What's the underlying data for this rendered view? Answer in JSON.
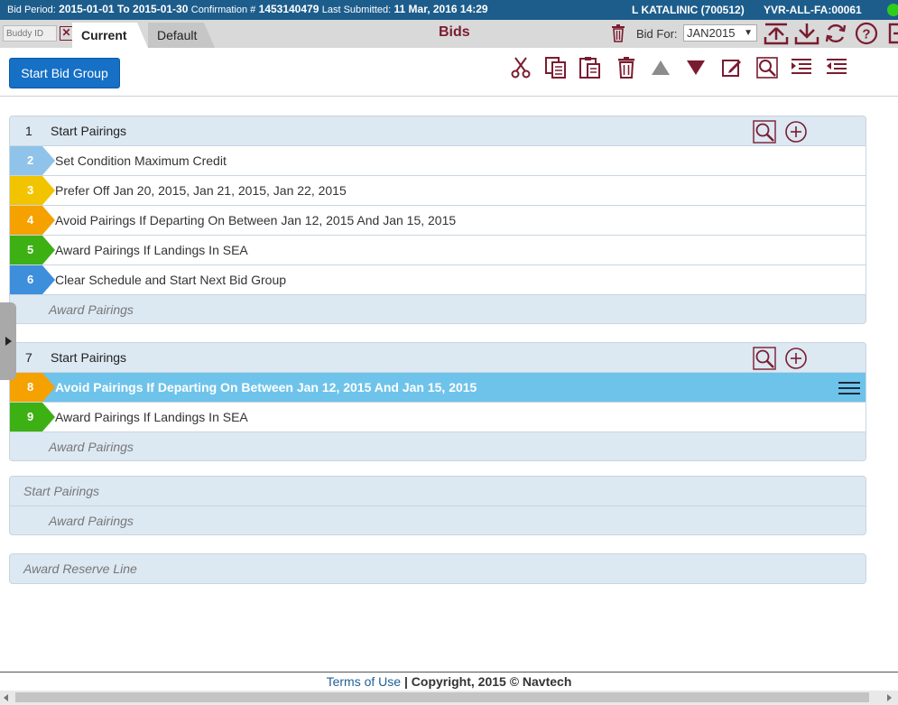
{
  "topbar": {
    "bid_period_label": "Bid Period:",
    "bid_period_value": "2015-01-01",
    "to_label": "To",
    "bid_period_end": "2015-01-30",
    "confirmation_label": "Confirmation #",
    "confirmation_value": "1453140479",
    "last_submitted_label": "Last Submitted:",
    "last_submitted_value": "11 Mar, 2016 14:29",
    "user": "L KATALINIC (700512)",
    "base": "YVR-ALL-FA:00061",
    "status_color": "#2ecc1b"
  },
  "tabs": {
    "buddy_placeholder": "Buddy ID",
    "current": "Current",
    "default": "Default",
    "page_title": "Bids",
    "bid_for_label": "Bid For:",
    "bid_for_value": "JAN2015"
  },
  "toolbar": {
    "start_bid_group": "Start Bid Group",
    "icons": [
      "cut-icon",
      "copy-icon",
      "paste-icon",
      "delete-icon",
      "move-up-icon",
      "move-down-icon",
      "edit-icon",
      "search-icon",
      "indent-icon",
      "outdent-icon"
    ]
  },
  "groups": [
    {
      "number": "1",
      "title": "Start Pairings",
      "rows": [
        {
          "number": "2",
          "text": "Set Condition Maximum Credit",
          "color": "#8fc3ea"
        },
        {
          "number": "3",
          "text": "Prefer Off Jan 20, 2015, Jan 21, 2015, Jan 22, 2015",
          "color": "#f2c400"
        },
        {
          "number": "4",
          "text": "Avoid Pairings If Departing On Between Jan 12, 2015 And Jan 15, 2015",
          "color": "#f5a100"
        },
        {
          "number": "5",
          "text": "Award Pairings If Landings In SEA",
          "color": "#3db014"
        },
        {
          "number": "6",
          "text": "Clear Schedule and Start Next Bid Group",
          "color": "#3d8fdc"
        }
      ],
      "award": "Award Pairings"
    },
    {
      "number": "7",
      "title": "Start Pairings",
      "rows": [
        {
          "number": "8",
          "text": "Avoid Pairings If Departing On Between Jan 12, 2015 And Jan 15, 2015",
          "color": "#f5a100",
          "selected": true
        },
        {
          "number": "9",
          "text": "Award Pairings If Landings In SEA",
          "color": "#3db014"
        }
      ],
      "award": "Award Pairings"
    }
  ],
  "empty_group": {
    "title": "Start Pairings",
    "award": "Award Pairings"
  },
  "reserve": {
    "title": "Award Reserve Line"
  },
  "footer": {
    "terms": "Terms of Use",
    "copyright": "Copyright, 2015 © Navtech"
  },
  "colors": {
    "brand_maroon": "#7a1c30",
    "topbar_blue": "#1d5d8c",
    "primary_button": "#1570c6",
    "selected_row": "#6ec3ea"
  }
}
